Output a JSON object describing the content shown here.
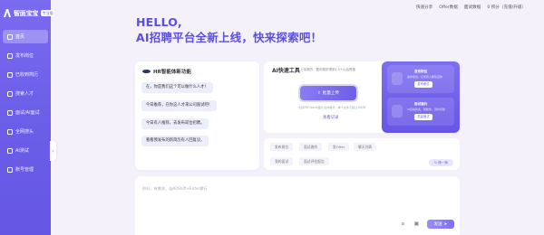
{
  "brand": {
    "name": "智面宝宝",
    "tag": "专业版"
  },
  "sidebar": {
    "items": [
      {
        "label": "首页",
        "icon": "home-icon",
        "active": true
      },
      {
        "label": "发布岗位",
        "icon": "publish-icon",
        "active": false
      },
      {
        "label": "已收到简历",
        "icon": "resume-icon",
        "active": false
      },
      {
        "label": "搜索人才",
        "icon": "search-talent-icon",
        "active": false
      },
      {
        "label": "面试/AI面试",
        "icon": "interview-icon",
        "active": false
      },
      {
        "label": "全网搜头",
        "icon": "global-search-icon",
        "active": false
      },
      {
        "label": "AI测试",
        "icon": "ai-test-icon",
        "active": false
      },
      {
        "label": "账号管理",
        "icon": "account-icon",
        "active": false
      }
    ],
    "collapse_glyph": "‹"
  },
  "topbar": {
    "links": [
      "快速分享",
      "Offer数据",
      "面试数据",
      "0 积分（充值/升级）"
    ]
  },
  "hero": {
    "line1": "HELLO,",
    "line2": "AI招聘平台全新上线，快来探索吧！"
  },
  "chat": {
    "header": "HR智能体新功能",
    "messages": [
      "在，你是我们这个可以做什么人才！",
      "今日推荐，在你这人才来公司面试吧！",
      "今日有人推荐，去发布岗位招聘。",
      "看看我发布的新简历有人回复没。"
    ]
  },
  "tools": {
    "title": "AI快速工具",
    "subtitle": "上传简历，看你简历得到1.5+以后再推",
    "upload_label": "批量上传",
    "upload_hint": "支持PDF/word/图片文件格式，单个文件不超过10MB",
    "view_record": "查看记录"
  },
  "side_cards": [
    {
      "title": "发布职位",
      "desc": "发布职位，让所有人都知道你",
      "button": "发布职位"
    },
    {
      "title": "面试邀约",
      "desc": "AI自动筛选，帮助你，用时尽量",
      "button": "发起面试"
    }
  ],
  "quick_tags": {
    "row1": [
      "发布岗位",
      "面试邀约",
      "发Offer",
      "聊天列表"
    ],
    "row2": [
      "我的面试",
      "面试评估报告"
    ],
    "swap_label": "换一换"
  },
  "input": {
    "placeholder": "你好，有需求，@AI/Shift+Enter换行",
    "send_label": "发送"
  }
}
